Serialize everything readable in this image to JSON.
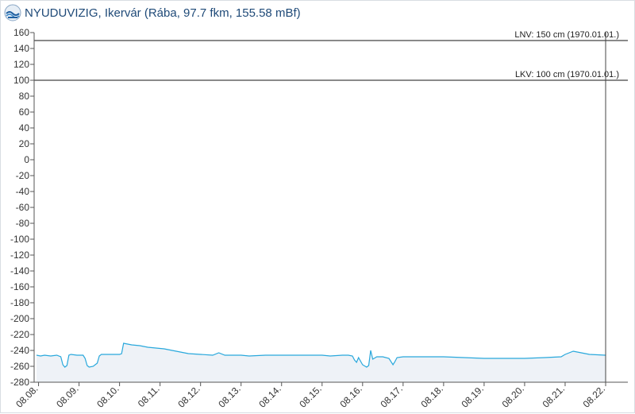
{
  "header": {
    "title": "NYUDUVIZIG, Ikervár (Rába, 97.7 fkm, 155.58 mBf)",
    "logo_icon": "water-agency-logo-icon"
  },
  "chart_data": {
    "type": "area",
    "title": "NYUDUVIZIG, Ikervár (Rába, 97.7 fkm, 155.58 mBf)",
    "xlabel": "",
    "ylabel": "",
    "ylim": [
      -280,
      160
    ],
    "yticks": [
      160,
      140,
      120,
      100,
      80,
      60,
      40,
      20,
      0,
      -20,
      -40,
      -60,
      -80,
      -100,
      -120,
      -140,
      -160,
      -180,
      -200,
      -220,
      -240,
      -260,
      -280
    ],
    "xlim": [
      7.95,
      22.0
    ],
    "xticks": [
      {
        "x": 8,
        "label": "08.08."
      },
      {
        "x": 9,
        "label": "08.09."
      },
      {
        "x": 10,
        "label": "08.10."
      },
      {
        "x": 11,
        "label": "08.11."
      },
      {
        "x": 12,
        "label": "08.12."
      },
      {
        "x": 13,
        "label": "08.13."
      },
      {
        "x": 14,
        "label": "08.14."
      },
      {
        "x": 15,
        "label": "08.15."
      },
      {
        "x": 16,
        "label": "08.16."
      },
      {
        "x": 17,
        "label": "08.17."
      },
      {
        "x": 18,
        "label": "08.18."
      },
      {
        "x": 19,
        "label": "08.19."
      },
      {
        "x": 20,
        "label": "08.20."
      },
      {
        "x": 21,
        "label": "08.21."
      },
      {
        "x": 22,
        "label": "08.22."
      }
    ],
    "grid": false,
    "line_color": "#29a8dc",
    "fill_color": "#eef2f7",
    "reference_lines": [
      {
        "value": 150,
        "label": "LNV: 150 cm (1970.01.01.)"
      },
      {
        "value": 100,
        "label": "LKV: 100 cm (1970.01.01.)"
      }
    ],
    "cursor_line": {
      "x": 22.0
    },
    "series": [
      {
        "x": [
          7.95,
          8.05,
          8.15,
          8.3,
          8.45,
          8.55,
          8.6,
          8.65,
          8.7,
          8.75,
          8.8,
          8.95,
          9.1,
          9.15,
          9.2,
          9.25,
          9.35,
          9.45,
          9.5,
          9.55,
          9.9,
          10.0,
          10.05,
          10.1,
          10.2,
          10.3,
          10.5,
          10.7,
          10.9,
          11.1,
          11.3,
          11.5,
          11.7,
          12.0,
          12.3,
          12.45,
          12.6,
          13.0,
          13.2,
          13.6,
          14.0,
          14.5,
          15.0,
          15.2,
          15.5,
          15.65,
          15.75,
          15.8,
          15.85,
          15.9,
          16.0,
          16.1,
          16.15,
          16.2,
          16.25,
          16.35,
          16.5,
          16.65,
          16.75,
          16.8,
          16.85,
          17.0,
          17.5,
          18.0,
          18.5,
          19.0,
          19.5,
          20.0,
          20.5,
          20.9,
          21.0,
          21.2,
          21.4,
          21.6,
          22.0
        ],
        "y": [
          -246,
          -247,
          -246,
          -247,
          -246,
          -248,
          -258,
          -261,
          -259,
          -246,
          -245,
          -246,
          -246,
          -250,
          -259,
          -261,
          -260,
          -256,
          -247,
          -245,
          -245,
          -245,
          -244,
          -231,
          -232,
          -233,
          -234,
          -236,
          -237,
          -238,
          -240,
          -242,
          -244,
          -245,
          -246,
          -243,
          -246,
          -246,
          -247,
          -246,
          -246,
          -246,
          -246,
          -247,
          -246,
          -246,
          -247,
          -252,
          -255,
          -249,
          -258,
          -261,
          -259,
          -240,
          -251,
          -248,
          -248,
          -250,
          -258,
          -254,
          -249,
          -248,
          -248,
          -248,
          -249,
          -250,
          -250,
          -250,
          -249,
          -248,
          -245,
          -241,
          -243,
          -245,
          -246
        ]
      }
    ]
  }
}
